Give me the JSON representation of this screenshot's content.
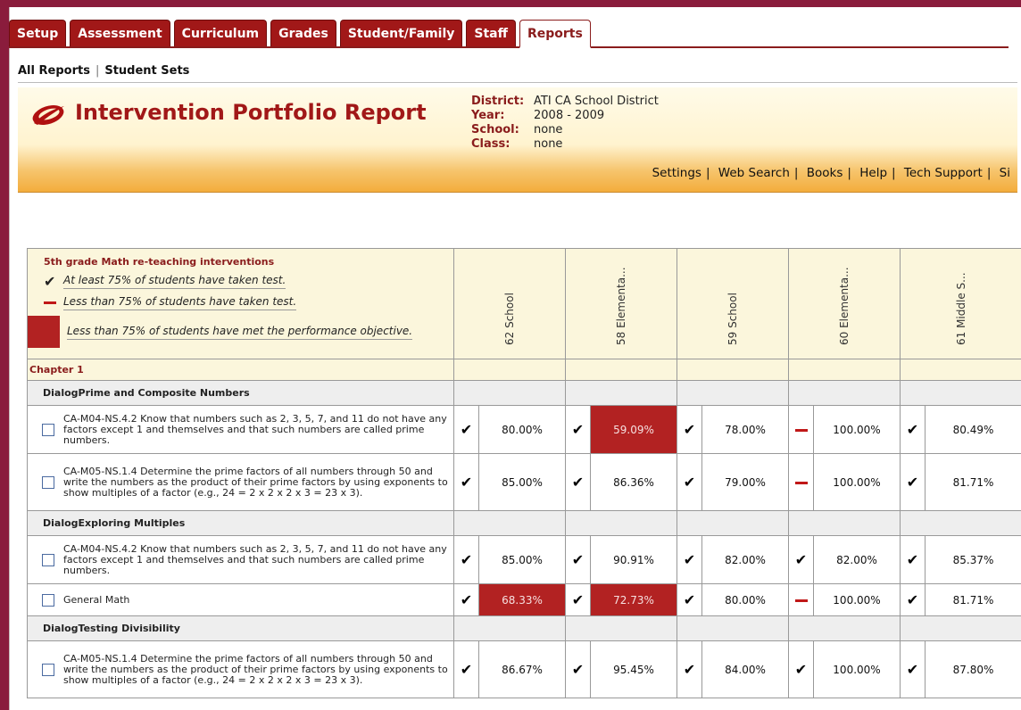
{
  "tabs": [
    "Setup",
    "Assessment",
    "Curriculum",
    "Grades",
    "Student/Family",
    "Staff",
    "Reports"
  ],
  "active_tab": "Reports",
  "subnav": {
    "all_reports": "All Reports",
    "student_sets": "Student Sets"
  },
  "header": {
    "title": "Intervention Portfolio Report",
    "district_label": "District:",
    "district": "ATI CA School District",
    "year_label": "Year:",
    "year": "2008 - 2009",
    "school_label": "School:",
    "school": "none",
    "class_label": "Class:",
    "class": "none"
  },
  "links": [
    "Settings",
    "Web Search",
    "Books",
    "Help",
    "Tech Support",
    "Si"
  ],
  "legend": {
    "title": "5th grade Math re-teaching interventions",
    "taken": "At least 75% of students have taken test.",
    "not_taken": "Less than 75% of students have taken test.",
    "not_met": "Less than 75% of students have met the performance objective."
  },
  "columns": [
    "62 School",
    "58 Elementa...",
    "59 School",
    "60 Elementa...",
    "61 Middle S..."
  ],
  "chapter": "Chapter 1",
  "groups": [
    {
      "name": "DialogPrime and Composite Numbers",
      "rows": [
        {
          "text": "CA-M04-NS.4.2 Know that numbers such as 2, 3, 5, 7, and 11 do not have any factors except 1 and themselves and that such numbers are called prime numbers.",
          "marks": [
            "check",
            "check",
            "check",
            "dash",
            "check"
          ],
          "values": [
            "80.00%",
            "59.09%",
            "78.00%",
            "100.00%",
            "80.49%"
          ],
          "red": [
            false,
            true,
            false,
            false,
            false
          ]
        },
        {
          "text": "CA-M05-NS.1.4 Determine the prime factors of all numbers through 50 and write the numbers as the product of their prime factors by using exponents to show multiples of a factor (e.g., 24 = 2 x 2 x 2 x 3 = 23 x 3).",
          "marks": [
            "check",
            "check",
            "check",
            "dash",
            "check"
          ],
          "values": [
            "85.00%",
            "86.36%",
            "79.00%",
            "100.00%",
            "81.71%"
          ],
          "red": [
            false,
            false,
            false,
            false,
            false
          ]
        }
      ]
    },
    {
      "name": "DialogExploring Multiples",
      "rows": [
        {
          "text": "CA-M04-NS.4.2 Know that numbers such as 2, 3, 5, 7, and 11 do not have any factors except 1 and themselves and that such numbers are called prime numbers.",
          "marks": [
            "check",
            "check",
            "check",
            "check",
            "check"
          ],
          "values": [
            "85.00%",
            "90.91%",
            "82.00%",
            "82.00%",
            "85.37%"
          ],
          "red": [
            false,
            false,
            false,
            false,
            false
          ]
        },
        {
          "text": "General Math",
          "marks": [
            "check",
            "check",
            "check",
            "dash",
            "check"
          ],
          "values": [
            "68.33%",
            "72.73%",
            "80.00%",
            "100.00%",
            "81.71%"
          ],
          "red": [
            true,
            true,
            false,
            false,
            false
          ]
        }
      ]
    },
    {
      "name": "DialogTesting Divisibility",
      "rows": [
        {
          "text": "CA-M05-NS.1.4 Determine the prime factors of all numbers through 50 and write the numbers as the product of their prime factors by using exponents to show multiples of a factor (e.g., 24 = 2 x 2 x 2 x 3 = 23 x 3).",
          "marks": [
            "check",
            "check",
            "check",
            "check",
            "check"
          ],
          "values": [
            "86.67%",
            "95.45%",
            "84.00%",
            "100.00%",
            "87.80%"
          ],
          "red": [
            false,
            false,
            false,
            false,
            false
          ]
        }
      ]
    }
  ],
  "colors": {
    "brand": "#8a1c3c",
    "tab": "#a11818",
    "warning_cell": "#b22222"
  },
  "icons": [
    "logo-swoosh-icon",
    "check-icon",
    "dash-icon"
  ]
}
